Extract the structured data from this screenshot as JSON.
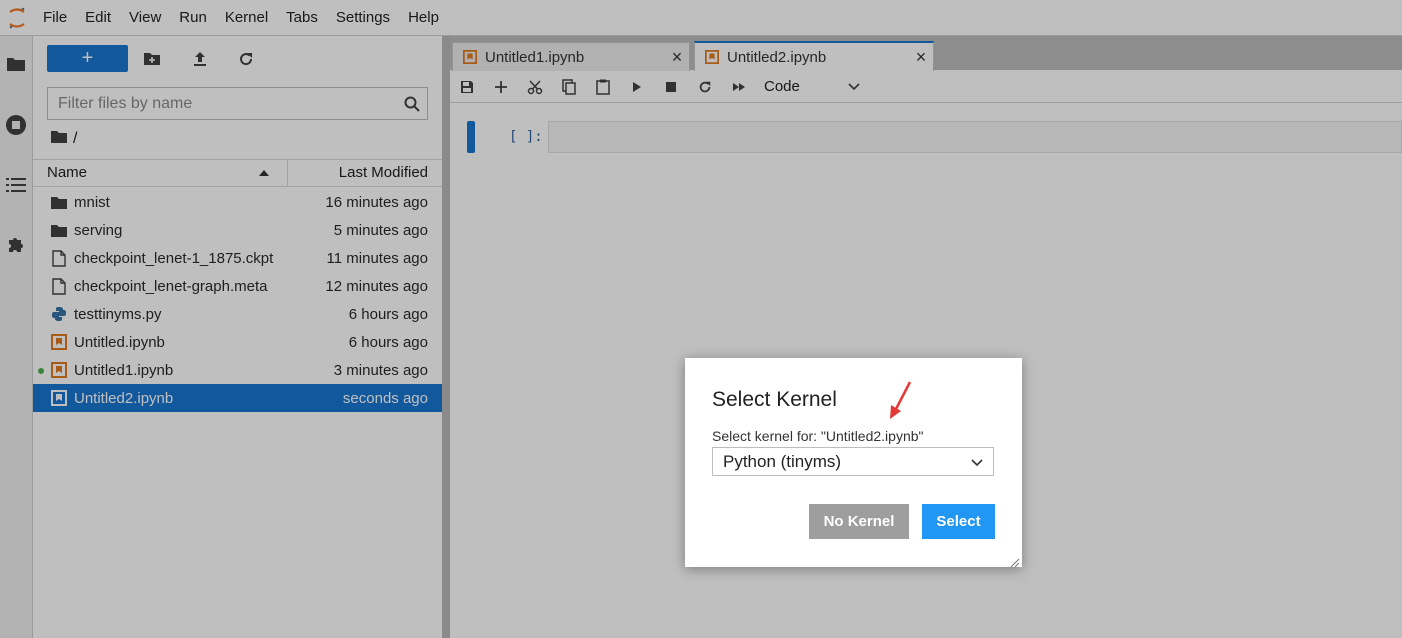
{
  "menubar": {
    "items": [
      "File",
      "Edit",
      "View",
      "Run",
      "Kernel",
      "Tabs",
      "Settings",
      "Help"
    ]
  },
  "activitybar": {
    "icons": [
      "folder-icon",
      "running-icon",
      "toc-icon",
      "extension-icon"
    ]
  },
  "file_browser": {
    "new_button_label": "+",
    "search_placeholder": "Filter files by name",
    "breadcrumb": "/",
    "columns": {
      "name": "Name",
      "modified": "Last Modified"
    },
    "items": [
      {
        "name": "mnist",
        "modified": "16 minutes ago",
        "icon": "folder-icon"
      },
      {
        "name": "serving",
        "modified": "5 minutes ago",
        "icon": "folder-icon"
      },
      {
        "name": "checkpoint_lenet-1_1875.ckpt",
        "modified": "11 minutes ago",
        "icon": "file-icon"
      },
      {
        "name": "checkpoint_lenet-graph.meta",
        "modified": "12 minutes ago",
        "icon": "file-icon"
      },
      {
        "name": "testtinyms.py",
        "modified": "6 hours ago",
        "icon": "python-icon"
      },
      {
        "name": "Untitled.ipynb",
        "modified": "6 hours ago",
        "icon": "notebook-icon"
      },
      {
        "name": "Untitled1.ipynb",
        "modified": "3 minutes ago",
        "icon": "notebook-icon",
        "running": true
      },
      {
        "name": "Untitled2.ipynb",
        "modified": "seconds ago",
        "icon": "notebook-icon",
        "selected": true
      }
    ]
  },
  "tabs": [
    {
      "label": "Untitled1.ipynb",
      "active": false
    },
    {
      "label": "Untitled2.ipynb",
      "active": true
    }
  ],
  "notebook": {
    "cell_type": "Code",
    "cell_prompt": "[ ]:"
  },
  "dialog": {
    "title": "Select Kernel",
    "label": "Select kernel for: \"Untitled2.ipynb\"",
    "selected_kernel": "Python (tinyms)",
    "no_kernel_label": "No Kernel",
    "select_label": "Select"
  },
  "colors": {
    "accent": "#1976d2",
    "select_button": "#2196f3",
    "no_kernel_button": "#9e9e9e",
    "notebook_icon": "#e07a1f",
    "arrow": "#e53935"
  }
}
